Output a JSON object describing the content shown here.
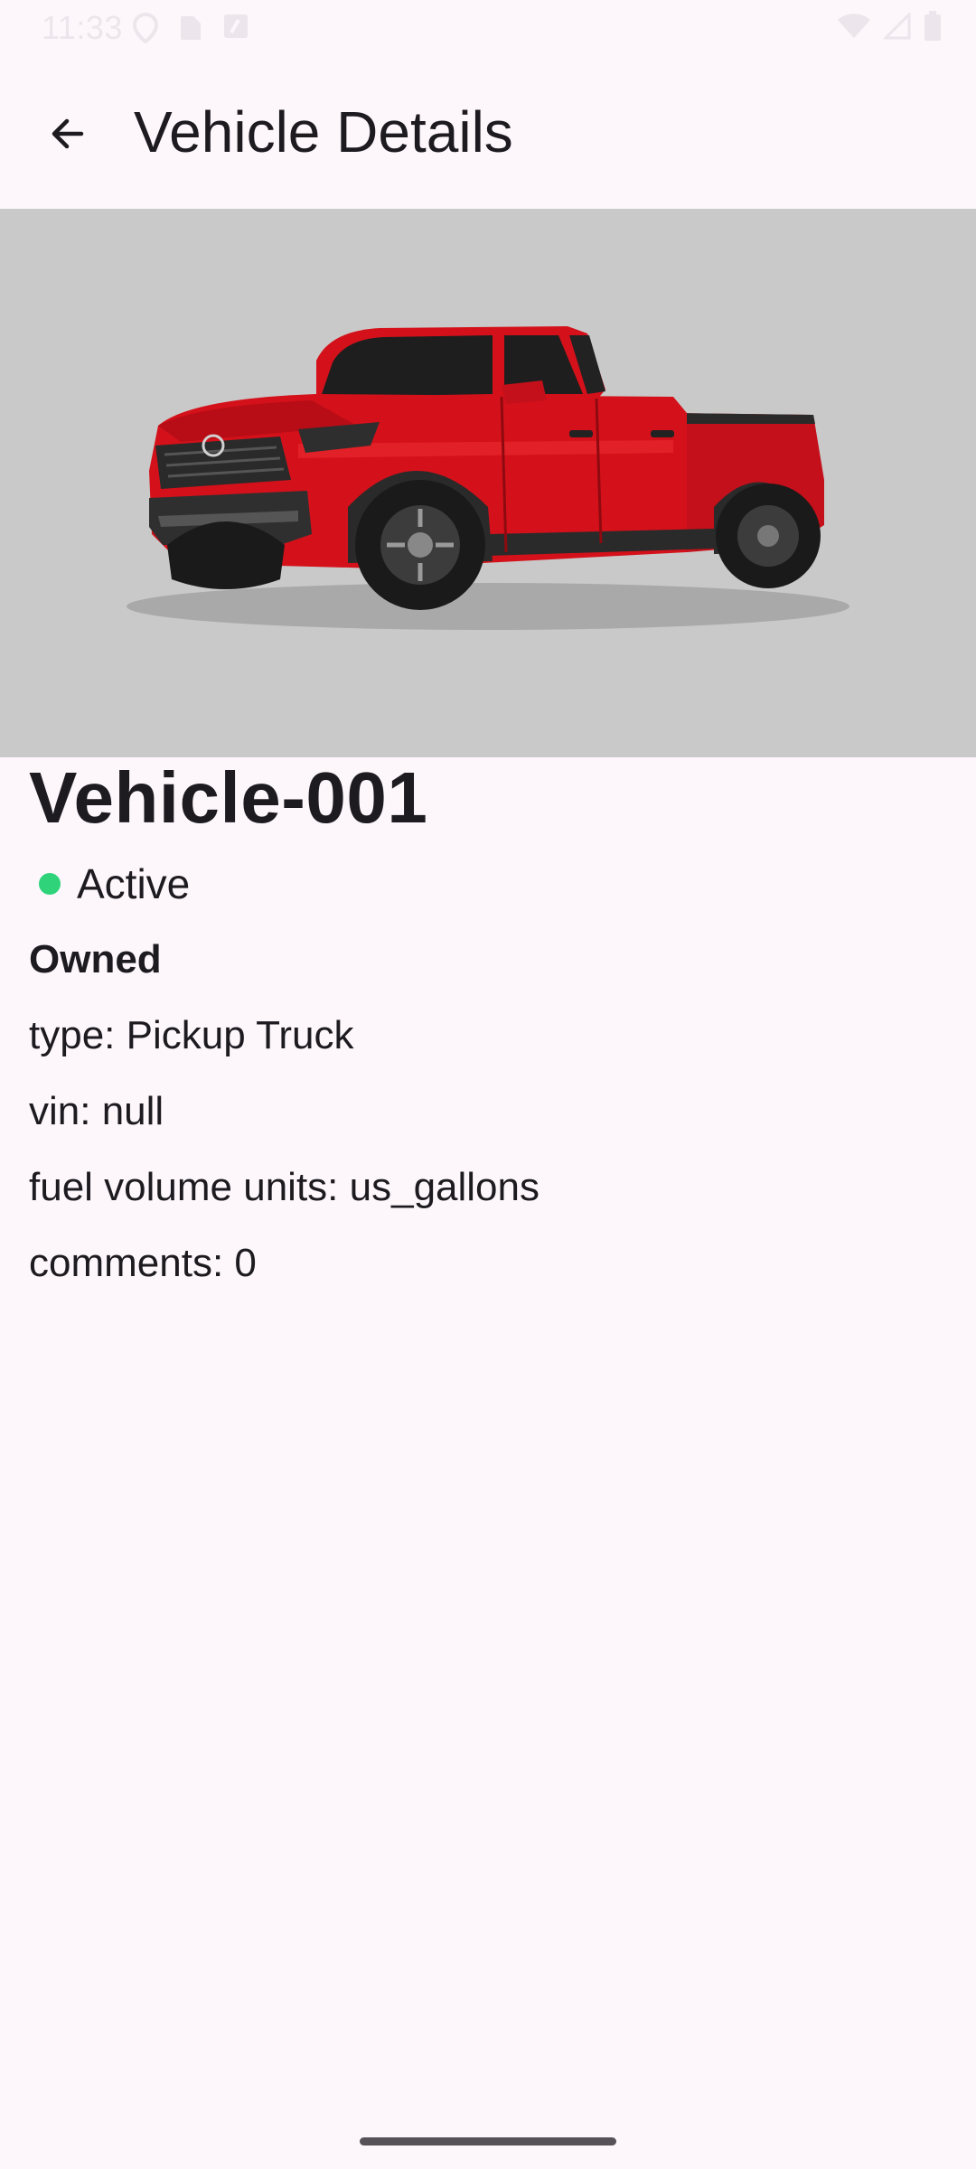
{
  "status_bar": {
    "time": "11:33"
  },
  "app_bar": {
    "title": "Vehicle Details",
    "back_icon": "arrow-back-icon"
  },
  "vehicle": {
    "name": "Vehicle-001",
    "status": "Active",
    "status_color": "#2FD47A",
    "ownership": "Owned",
    "type_line": "type: Pickup Truck",
    "vin_line": "vin: null",
    "fuel_units_line": "fuel volume units: us_gallons",
    "comments_line": "comments: 0"
  },
  "colors": {
    "background": "#FDF7FC",
    "image_background": "#C9C9C9",
    "text": "#1D1B20",
    "truck_red": "#D4111A"
  }
}
